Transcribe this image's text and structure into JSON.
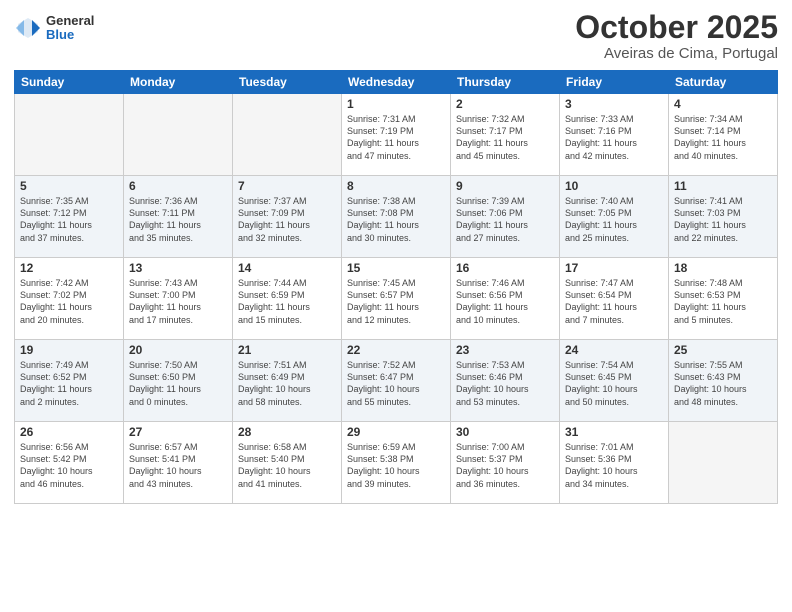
{
  "header": {
    "logo": {
      "general": "General",
      "blue": "Blue"
    },
    "title": "October 2025",
    "location": "Aveiras de Cima, Portugal"
  },
  "calendar": {
    "days_of_week": [
      "Sunday",
      "Monday",
      "Tuesday",
      "Wednesday",
      "Thursday",
      "Friday",
      "Saturday"
    ],
    "weeks": [
      {
        "shaded": false,
        "days": [
          {
            "num": "",
            "info": ""
          },
          {
            "num": "",
            "info": ""
          },
          {
            "num": "",
            "info": ""
          },
          {
            "num": "1",
            "info": "Sunrise: 7:31 AM\nSunset: 7:19 PM\nDaylight: 11 hours\nand 47 minutes."
          },
          {
            "num": "2",
            "info": "Sunrise: 7:32 AM\nSunset: 7:17 PM\nDaylight: 11 hours\nand 45 minutes."
          },
          {
            "num": "3",
            "info": "Sunrise: 7:33 AM\nSunset: 7:16 PM\nDaylight: 11 hours\nand 42 minutes."
          },
          {
            "num": "4",
            "info": "Sunrise: 7:34 AM\nSunset: 7:14 PM\nDaylight: 11 hours\nand 40 minutes."
          }
        ]
      },
      {
        "shaded": true,
        "days": [
          {
            "num": "5",
            "info": "Sunrise: 7:35 AM\nSunset: 7:12 PM\nDaylight: 11 hours\nand 37 minutes."
          },
          {
            "num": "6",
            "info": "Sunrise: 7:36 AM\nSunset: 7:11 PM\nDaylight: 11 hours\nand 35 minutes."
          },
          {
            "num": "7",
            "info": "Sunrise: 7:37 AM\nSunset: 7:09 PM\nDaylight: 11 hours\nand 32 minutes."
          },
          {
            "num": "8",
            "info": "Sunrise: 7:38 AM\nSunset: 7:08 PM\nDaylight: 11 hours\nand 30 minutes."
          },
          {
            "num": "9",
            "info": "Sunrise: 7:39 AM\nSunset: 7:06 PM\nDaylight: 11 hours\nand 27 minutes."
          },
          {
            "num": "10",
            "info": "Sunrise: 7:40 AM\nSunset: 7:05 PM\nDaylight: 11 hours\nand 25 minutes."
          },
          {
            "num": "11",
            "info": "Sunrise: 7:41 AM\nSunset: 7:03 PM\nDaylight: 11 hours\nand 22 minutes."
          }
        ]
      },
      {
        "shaded": false,
        "days": [
          {
            "num": "12",
            "info": "Sunrise: 7:42 AM\nSunset: 7:02 PM\nDaylight: 11 hours\nand 20 minutes."
          },
          {
            "num": "13",
            "info": "Sunrise: 7:43 AM\nSunset: 7:00 PM\nDaylight: 11 hours\nand 17 minutes."
          },
          {
            "num": "14",
            "info": "Sunrise: 7:44 AM\nSunset: 6:59 PM\nDaylight: 11 hours\nand 15 minutes."
          },
          {
            "num": "15",
            "info": "Sunrise: 7:45 AM\nSunset: 6:57 PM\nDaylight: 11 hours\nand 12 minutes."
          },
          {
            "num": "16",
            "info": "Sunrise: 7:46 AM\nSunset: 6:56 PM\nDaylight: 11 hours\nand 10 minutes."
          },
          {
            "num": "17",
            "info": "Sunrise: 7:47 AM\nSunset: 6:54 PM\nDaylight: 11 hours\nand 7 minutes."
          },
          {
            "num": "18",
            "info": "Sunrise: 7:48 AM\nSunset: 6:53 PM\nDaylight: 11 hours\nand 5 minutes."
          }
        ]
      },
      {
        "shaded": true,
        "days": [
          {
            "num": "19",
            "info": "Sunrise: 7:49 AM\nSunset: 6:52 PM\nDaylight: 11 hours\nand 2 minutes."
          },
          {
            "num": "20",
            "info": "Sunrise: 7:50 AM\nSunset: 6:50 PM\nDaylight: 11 hours\nand 0 minutes."
          },
          {
            "num": "21",
            "info": "Sunrise: 7:51 AM\nSunset: 6:49 PM\nDaylight: 10 hours\nand 58 minutes."
          },
          {
            "num": "22",
            "info": "Sunrise: 7:52 AM\nSunset: 6:47 PM\nDaylight: 10 hours\nand 55 minutes."
          },
          {
            "num": "23",
            "info": "Sunrise: 7:53 AM\nSunset: 6:46 PM\nDaylight: 10 hours\nand 53 minutes."
          },
          {
            "num": "24",
            "info": "Sunrise: 7:54 AM\nSunset: 6:45 PM\nDaylight: 10 hours\nand 50 minutes."
          },
          {
            "num": "25",
            "info": "Sunrise: 7:55 AM\nSunset: 6:43 PM\nDaylight: 10 hours\nand 48 minutes."
          }
        ]
      },
      {
        "shaded": false,
        "days": [
          {
            "num": "26",
            "info": "Sunrise: 6:56 AM\nSunset: 5:42 PM\nDaylight: 10 hours\nand 46 minutes."
          },
          {
            "num": "27",
            "info": "Sunrise: 6:57 AM\nSunset: 5:41 PM\nDaylight: 10 hours\nand 43 minutes."
          },
          {
            "num": "28",
            "info": "Sunrise: 6:58 AM\nSunset: 5:40 PM\nDaylight: 10 hours\nand 41 minutes."
          },
          {
            "num": "29",
            "info": "Sunrise: 6:59 AM\nSunset: 5:38 PM\nDaylight: 10 hours\nand 39 minutes."
          },
          {
            "num": "30",
            "info": "Sunrise: 7:00 AM\nSunset: 5:37 PM\nDaylight: 10 hours\nand 36 minutes."
          },
          {
            "num": "31",
            "info": "Sunrise: 7:01 AM\nSunset: 5:36 PM\nDaylight: 10 hours\nand 34 minutes."
          },
          {
            "num": "",
            "info": ""
          }
        ]
      }
    ]
  }
}
